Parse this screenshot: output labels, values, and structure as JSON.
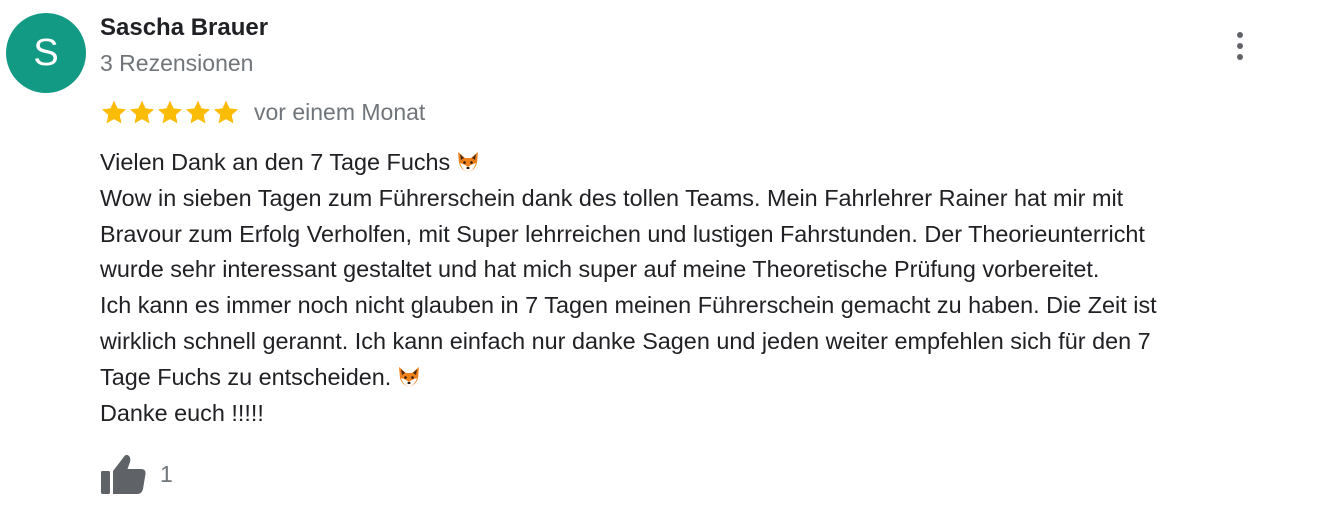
{
  "reviewer": {
    "initial": "S",
    "name": "Sascha Brauer",
    "review_count": "3 Rezensionen",
    "avatar_color": "#139a85"
  },
  "rating": {
    "stars": 5,
    "max_stars": 5,
    "star_color": "#fbbc04",
    "date": "vor einem Monat"
  },
  "review": {
    "lines": [
      "Vielen Dank an den 7 Tage Fuchs",
      "Wow in sieben Tagen zum Führerschein dank des tollen Teams. Mein Fahrlehrer Rainer hat mir mit",
      "Bravour zum Erfolg Verholfen, mit Super lehrreichen und lustigen Fahrstunden. Der Theorieunterricht",
      "wurde sehr interessant gestaltet und hat mich super auf meine Theoretische Prüfung vorbereitet.",
      "Ich kann es immer noch nicht glauben in 7 Tagen meinen Führerschein gemacht zu haben. Die Zeit ist",
      "wirklich schnell gerannt. Ich kann einfach nur danke Sagen und jeden weiter empfehlen sich für den 7",
      "Tage Fuchs zu entscheiden.",
      "Danke euch !!!!!"
    ],
    "emoji": "fox-face-icon"
  },
  "actions": {
    "like_count": "1",
    "like_icon": "thumbs-up-icon",
    "menu_icon": "more-vert-icon"
  }
}
